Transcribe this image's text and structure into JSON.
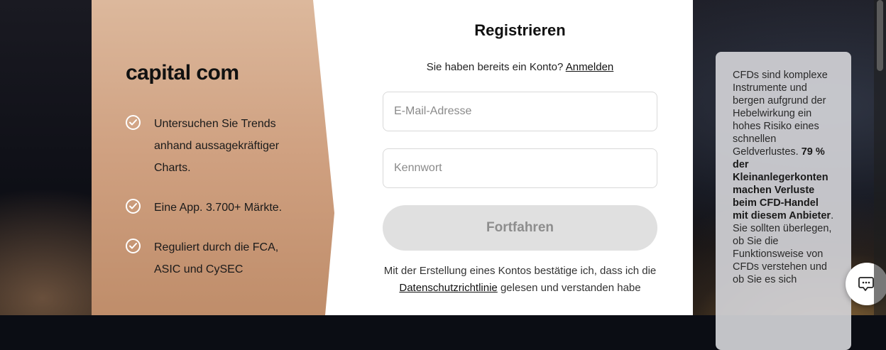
{
  "brand": {
    "logo_text": "capital com",
    "features": [
      "Untersuchen Sie Trends anhand aussagekräftiger Charts.",
      "Eine App. 3.700+ Märkte.",
      "Reguliert durch die FCA, ASIC und CySEC"
    ]
  },
  "form": {
    "title": "Registrieren",
    "login_prompt": "Sie haben bereits ein Konto?",
    "login_link": "Anmelden",
    "email_placeholder": "E-Mail-Adresse",
    "password_placeholder": "Kennwort",
    "submit_label": "Fortfahren",
    "terms_prefix": "Mit der Erstellung eines Kontos bestätige ich, dass ich die",
    "terms_link": "Datenschutzrichtlinie",
    "terms_suffix": "gelesen und verstanden habe"
  },
  "risk_warning": {
    "intro": "CFDs sind komplexe Instrumente und bergen aufgrund der Hebelwirkung ein hohes Risiko eines schnellen Geldverlustes.",
    "bold": "79 % der Kleinanlegerkonten machen Verluste beim CFD-Handel mit diesem Anbieter",
    "outro": ". Sie sollten überlegen, ob Sie die Funktionsweise von CFDs verstehen und ob Sie es sich"
  },
  "colors": {
    "brand_panel": "#cfa080",
    "button_disabled": "#e0e0e0",
    "risk_box": "#d2d2d7"
  },
  "icons": {
    "feature": "check-circle-icon",
    "chat": "chat-bubble-icon"
  }
}
